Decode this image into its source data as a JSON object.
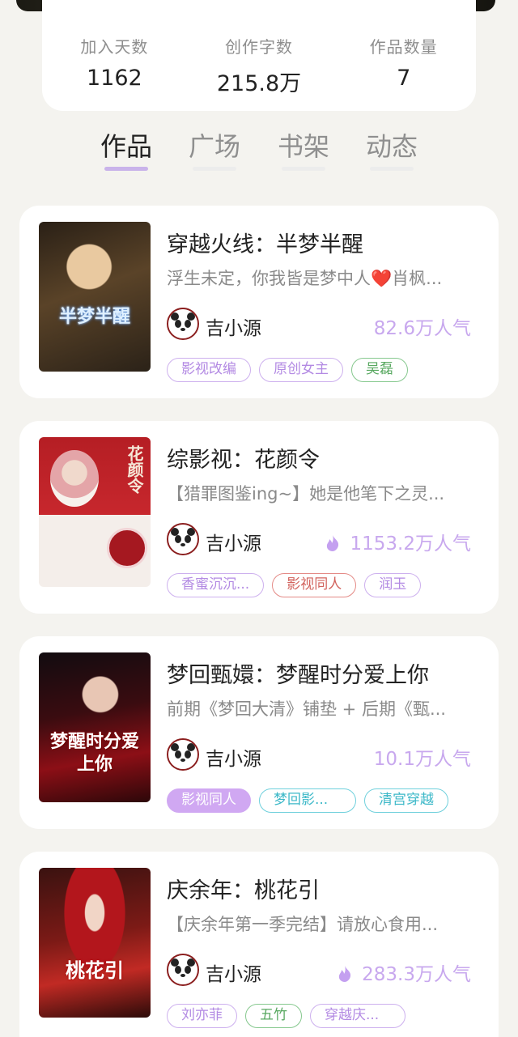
{
  "stats": [
    {
      "label": "加入天数",
      "value": "1162"
    },
    {
      "label": "创作字数",
      "value": "215.8万"
    },
    {
      "label": "作品数量",
      "value": "7"
    }
  ],
  "tabs": [
    "作品",
    "广场",
    "书架",
    "动态"
  ],
  "active_tab": "作品",
  "books": [
    {
      "title": "穿越火线：半梦半醒",
      "description": "浮生未定，你我皆是梦中人❤️肖枫...",
      "author": "吉小源",
      "popularity": "82.6万人气",
      "hot": false,
      "cover_text": "半梦半醒",
      "tags": [
        {
          "label": "影视改编",
          "style": "purple"
        },
        {
          "label": "原创女主",
          "style": "purple"
        },
        {
          "label": "吴磊",
          "style": "green"
        }
      ]
    },
    {
      "title": "综影视：花颜令",
      "description": "【猎罪图鉴ing~】她是他笔下之灵...",
      "author": "吉小源",
      "popularity": "1153.2万人气",
      "hot": true,
      "cover_text": "花颜令",
      "tags": [
        {
          "label": "香蜜沉沉...",
          "style": "purple"
        },
        {
          "label": "影视同人",
          "style": "red"
        },
        {
          "label": "润玉",
          "style": "purple"
        }
      ]
    },
    {
      "title": "梦回甄嬛：梦醒时分爱上你",
      "description": "前期《梦回大清》铺垫 + 后期《甄...",
      "author": "吉小源",
      "popularity": "10.1万人气",
      "hot": false,
      "cover_text": "梦醒时分爱上你",
      "tags": [
        {
          "label": "影视同人",
          "style": "filled"
        },
        {
          "label": "梦回影...",
          "style": "cyan"
        },
        {
          "label": "清宫穿越",
          "style": "cyan"
        }
      ]
    },
    {
      "title": "庆余年：桃花引",
      "description": "【庆余年第一季完结】请放心食用...",
      "author": "吉小源",
      "popularity": "283.3万人气",
      "hot": true,
      "cover_text": "桃花引",
      "tags": [
        {
          "label": "刘亦菲",
          "style": "purple"
        },
        {
          "label": "五竹",
          "style": "green"
        },
        {
          "label": "穿越庆...",
          "style": "purple"
        }
      ]
    }
  ],
  "icons": {
    "flame": "flame-icon",
    "avatar": "panda-avatar"
  },
  "colors": {
    "accent": "#c9b3ea",
    "popularity": "#c8a8ee"
  }
}
